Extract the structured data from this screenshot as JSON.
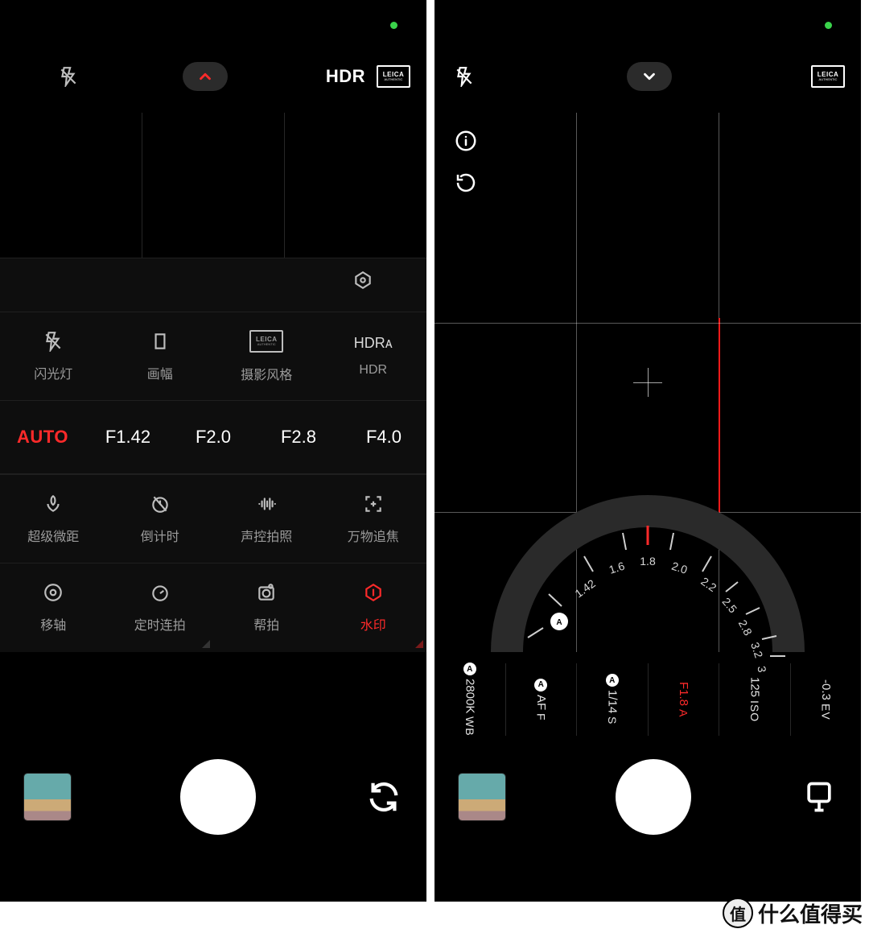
{
  "watermark": "什么值得买",
  "wm_badge": "值",
  "left": {
    "topbar": {
      "hdr": "HDR",
      "leica_top": "LEICA",
      "leica_bottom": "AUTHENTIC"
    },
    "aperture_values": {
      "auto": "AUTO",
      "v1": "F1.42",
      "v2": "F2.0",
      "v3": "F2.8",
      "v4": "F4.0"
    },
    "tools_row1": {
      "flash": "闪光灯",
      "aspect": "画幅",
      "style": "摄影风格",
      "hdr": "HDR",
      "hdr_badge": "HDRᴀ",
      "leica_top": "LEICA",
      "leica_bottom": "AUTHENTIC"
    },
    "tools_row2": {
      "macro": "超级微距",
      "timer": "倒计时",
      "voice": "声控拍照",
      "track": "万物追焦"
    },
    "tools_row3": {
      "tilt": "移轴",
      "interval": "定时连拍",
      "assist": "帮拍",
      "watermark": "水印"
    }
  },
  "right": {
    "topbar": {
      "leica_top": "LEICA",
      "leica_bottom": "AUTHENTIC"
    },
    "dial": {
      "t0": "1.42",
      "t1": "1.6",
      "t2": "1.8",
      "t3": "2.0",
      "t4": "2.2",
      "t5": "2.5",
      "t6": "2.8",
      "t7": "3.2",
      "t8": "3"
    },
    "params": {
      "wb": {
        "lbl": "WB",
        "val": "2800K",
        "auto": "A"
      },
      "af": {
        "lbl": "F",
        "val": "AF",
        "auto": "A"
      },
      "s": {
        "lbl": "S",
        "val": "1/14",
        "auto": "A"
      },
      "a": {
        "lbl": "A",
        "val": "F1.8"
      },
      "iso": {
        "lbl": "ISO",
        "val": "125"
      },
      "ev": {
        "lbl": "EV",
        "val": "-0.3"
      }
    }
  }
}
